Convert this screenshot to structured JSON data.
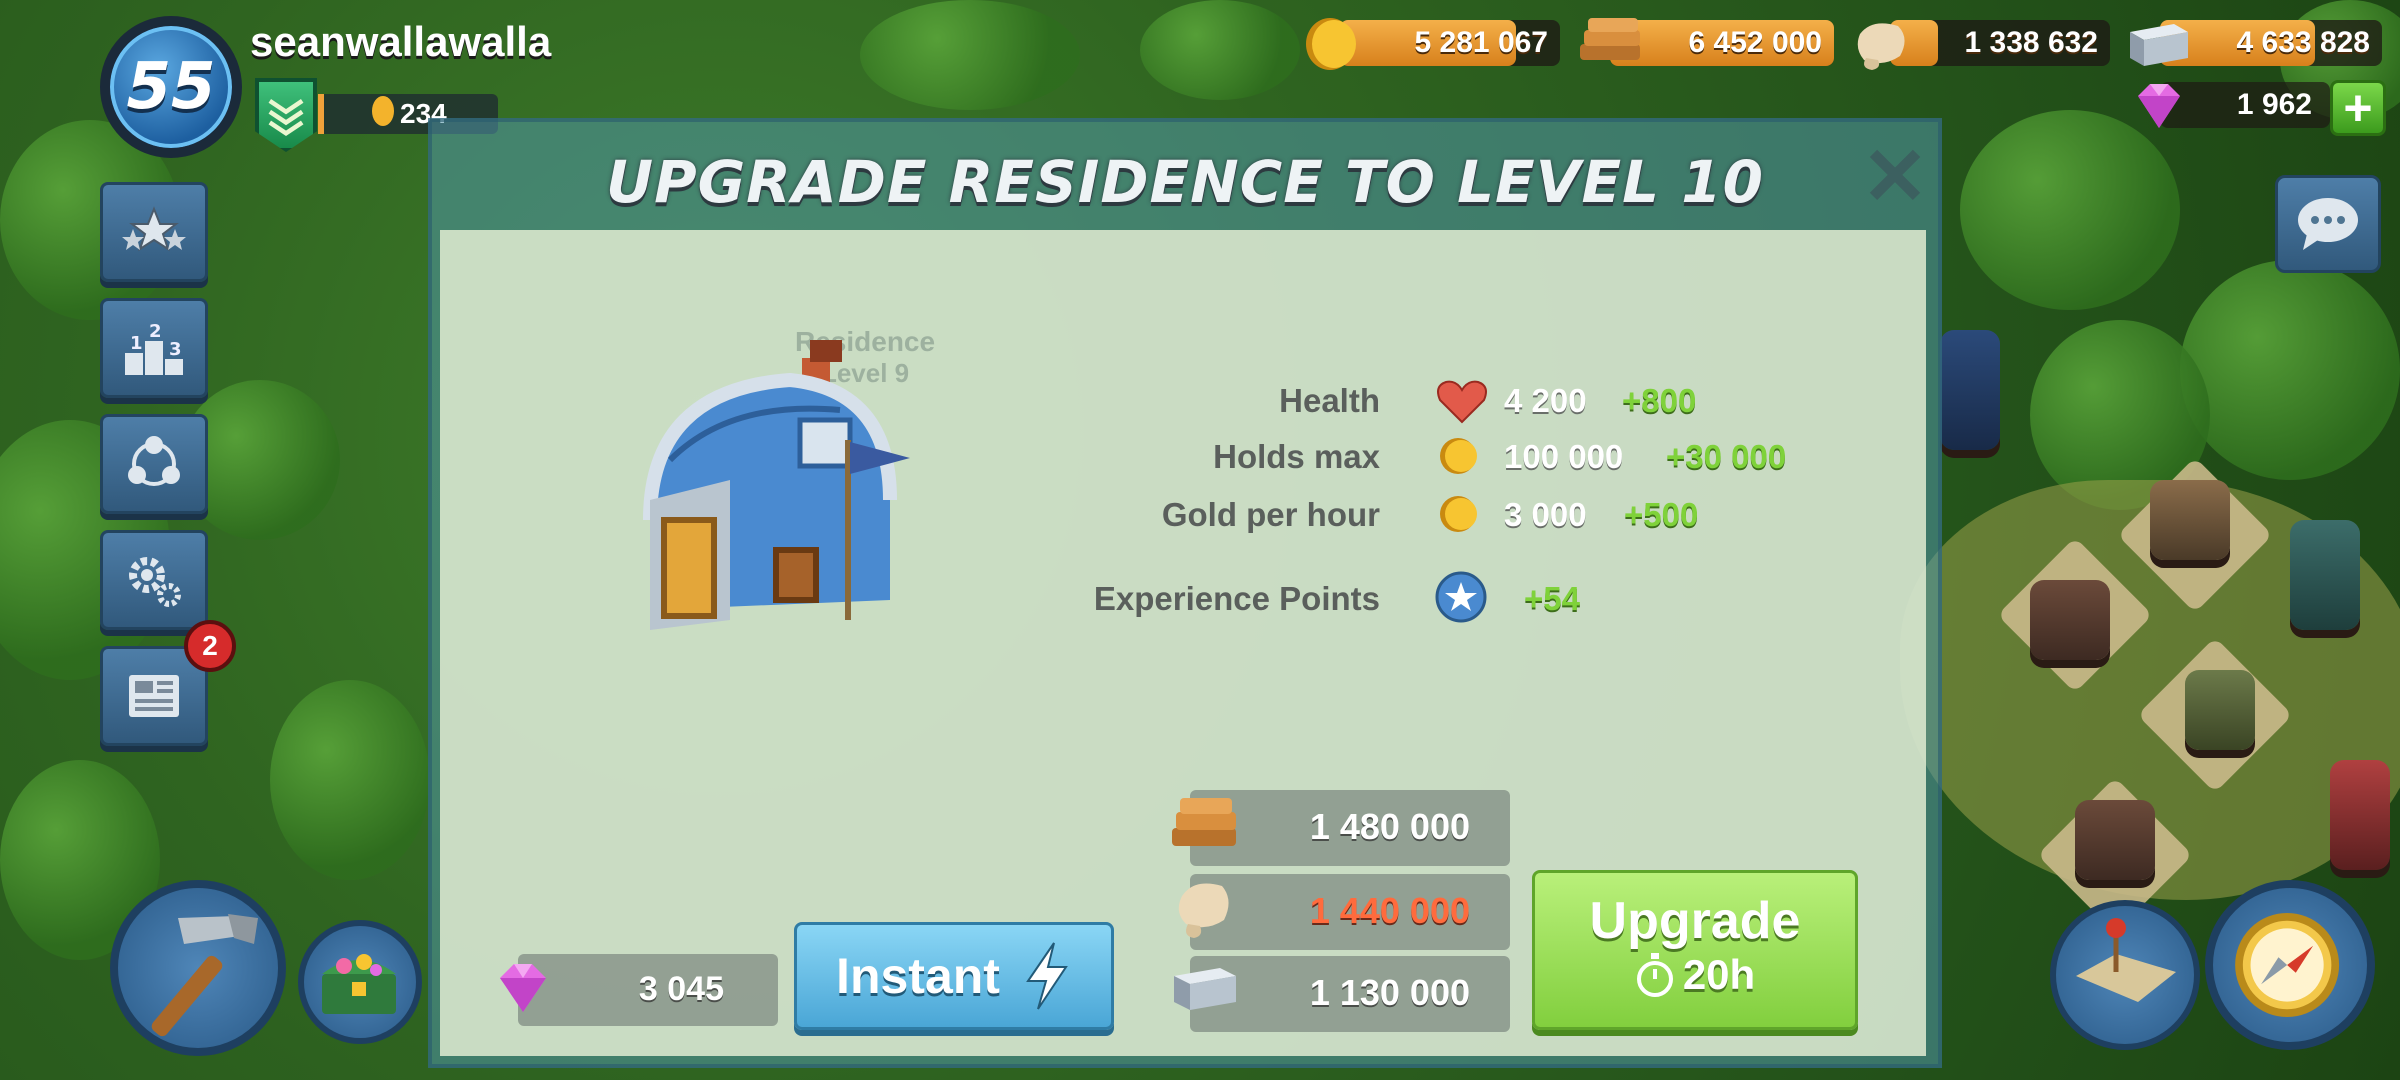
{
  "player": {
    "level": "55",
    "name": "seanwallawalla",
    "rank_points": "234"
  },
  "resources": {
    "gold": "5 281 067",
    "wood": "6 452 000",
    "stone": "1 338 632",
    "iron": "4 633 828",
    "gems": "1 962"
  },
  "sidebar": {
    "news_badge": "2"
  },
  "dialog": {
    "title": "UPGRADE RESIDENCE TO LEVEL 10",
    "building_name": "Residence",
    "building_level": "Level 9",
    "stats": [
      {
        "label": "Health",
        "value": "4 200",
        "bonus": "+800",
        "icon": "heart-icon"
      },
      {
        "label": "Holds max",
        "value": "100 000",
        "bonus": "+30 000",
        "icon": "gold-coin-icon"
      },
      {
        "label": "Gold per hour",
        "value": "3 000",
        "bonus": "+500",
        "icon": "gold-coin-icon"
      },
      {
        "label": "Experience Points",
        "value": "",
        "bonus": "+54",
        "icon": "star-icon"
      }
    ],
    "costs": {
      "wood": "1 480 000",
      "stone": "1 440 000",
      "iron": "1 130 000"
    },
    "gem_cost": "3 045",
    "instant_label": "Instant",
    "upgrade_label": "Upgrade",
    "upgrade_time": "20h"
  },
  "colors": {
    "insufficient": "#ff6b3d",
    "bonus": "#7fd23a",
    "upgrade": "#8fd94a",
    "instant": "#5fb8e2"
  }
}
